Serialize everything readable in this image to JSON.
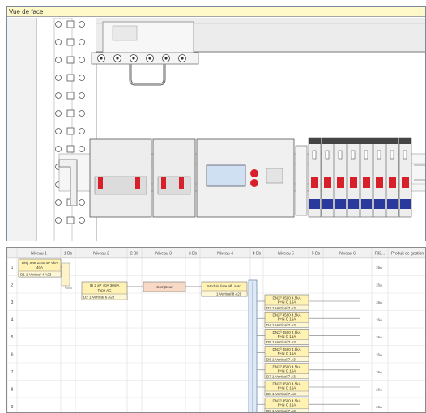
{
  "front_view": {
    "title": "Vue de face"
  },
  "schematic": {
    "headers": [
      "Niveau 1",
      "1 Bb",
      "Niveau 2",
      "2 Bb",
      "Niveau 3",
      "3 Bb",
      "Niveau 4",
      "4 Bb",
      "Niveau 5",
      "5 Bb",
      "Niveau 6",
      "Fil2...",
      "Produit de gestion"
    ],
    "rows": [
      "1",
      "2",
      "3",
      "4",
      "5",
      "6",
      "7",
      "8",
      "9"
    ],
    "currents": [
      "16A",
      "16A",
      "16A",
      "16A",
      "16A",
      "16A",
      "16A",
      "16A",
      "16A"
    ],
    "level1_box": {
      "line1": "Disj. tête 2x40 4P 6kA",
      "line2": "40A",
      "footer": "D1   1 Vertical  4 A23"
    },
    "level2_box": {
      "line1": "ID 2 xP 40A 30mA",
      "line2": "Type AC",
      "footer": "D2   1 Vertical  6 A28"
    },
    "level3_box": {
      "line1": "Compteur"
    },
    "level4_box": {
      "line1": "Module liste aff. auto",
      "footer": "1 Vertical  8 A29"
    },
    "level5_boxes": [
      {
        "line1": "DNX³ 4500 4,5kA",
        "line2": "P+N C 16A",
        "footer": "D3   1 Vertical  7 A3"
      },
      {
        "line1": "DNX³ 4500 4,5kA",
        "line2": "P+N C 16A",
        "footer": "D4   1 Vertical  7 A3"
      },
      {
        "line1": "DNX³ 4500 4,5kA",
        "line2": "P+N C 16A",
        "footer": "D5   1 Vertical  7 A3"
      },
      {
        "line1": "DNX³ 4500 4,5kA",
        "line2": "P+N C 16A",
        "footer": "D6   1 Vertical  7 A3"
      },
      {
        "line1": "DNX³ 4500 4,5kA",
        "line2": "P+N C 16A",
        "footer": "D7   1 Vertical  7 A3"
      },
      {
        "line1": "DNX³ 4500 4,5kA",
        "line2": "P+N C 16A",
        "footer": "D8   1 Vertical  7 A3"
      },
      {
        "line1": "DNX³ 4500 4,5kA",
        "line2": "P+N C 16A",
        "footer": "D9   1 Vertical  7 A3"
      }
    ]
  },
  "colors": {
    "box_yellow": "#fff2b3",
    "box_pink": "#f8d9c6",
    "box_blue": "#dde9f7",
    "accent_red": "#d8202a"
  }
}
